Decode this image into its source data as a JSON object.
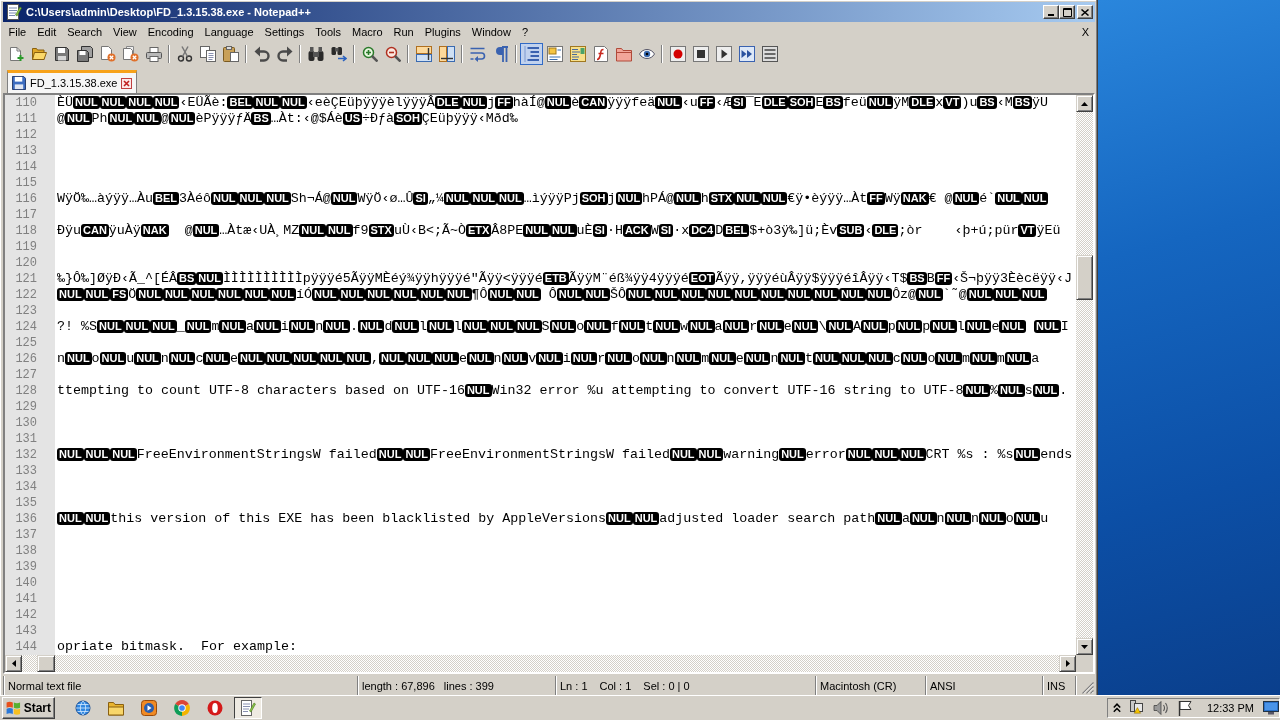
{
  "window": {
    "title": "C:\\Users\\admin\\Desktop\\FD_1.3.15.38.exe - Notepad++"
  },
  "menu": {
    "items": [
      "File",
      "Edit",
      "Search",
      "View",
      "Encoding",
      "Language",
      "Settings",
      "Tools",
      "Macro",
      "Run",
      "Plugins",
      "Window",
      "?"
    ],
    "close": "X"
  },
  "toolbar": [
    [
      {
        "kind": "new",
        "on": false
      },
      {
        "kind": "open",
        "on": false
      },
      {
        "kind": "save",
        "on": false
      },
      {
        "kind": "saveall",
        "on": false
      },
      {
        "kind": "close",
        "on": false
      },
      {
        "kind": "closeall",
        "on": false
      },
      {
        "kind": "print",
        "on": false
      }
    ],
    [
      {
        "kind": "cut",
        "on": false
      },
      {
        "kind": "copy",
        "on": false
      },
      {
        "kind": "paste",
        "on": false
      }
    ],
    [
      {
        "kind": "undo",
        "on": false
      },
      {
        "kind": "redo",
        "on": false
      }
    ],
    [
      {
        "kind": "find",
        "on": false
      },
      {
        "kind": "replace",
        "on": false
      }
    ],
    [
      {
        "kind": "zoomin",
        "on": false
      },
      {
        "kind": "zoomout",
        "on": false
      }
    ],
    [
      {
        "kind": "syncv",
        "on": false
      },
      {
        "kind": "synch",
        "on": false
      }
    ],
    [
      {
        "kind": "wrap",
        "on": false
      },
      {
        "kind": "allchars",
        "on": false
      }
    ],
    [
      {
        "kind": "indent",
        "on": true
      },
      {
        "kind": "userlang",
        "on": false
      },
      {
        "kind": "docmap",
        "on": false
      },
      {
        "kind": "funclist",
        "on": false
      },
      {
        "kind": "folder",
        "on": false
      },
      {
        "kind": "monitor",
        "on": false
      }
    ],
    [
      {
        "kind": "record",
        "on": false
      },
      {
        "kind": "stop",
        "on": false
      },
      {
        "kind": "play",
        "on": false
      },
      {
        "kind": "playmulti",
        "on": false
      },
      {
        "kind": "savemacro",
        "on": false
      }
    ]
  ],
  "tabs": [
    {
      "label": "FD_1.3.15.38.exe",
      "selected": true,
      "modified": false
    }
  ],
  "editor": {
    "lines": [
      {
        "number": "110",
        "segments": [
          {
            "kind": "text",
            "text": "ÈÜ"
          },
          {
            "kind": "control",
            "text": "NUL"
          },
          {
            "kind": "control",
            "text": "NUL"
          },
          {
            "kind": "control",
            "text": "NUL"
          },
          {
            "kind": "control",
            "text": "NUL"
          },
          {
            "kind": "text",
            "text": "‹EÜÃè:"
          },
          {
            "kind": "control",
            "text": "BEL"
          },
          {
            "kind": "control",
            "text": "NUL"
          },
          {
            "kind": "control",
            "text": "NUL"
          },
          {
            "kind": "text",
            "text": "‹eèÇEüþÿÿÿèlÿÿÿÂ"
          },
          {
            "kind": "control",
            "text": "DLE"
          },
          {
            "kind": "control",
            "text": "NUL"
          },
          {
            "kind": "text",
            "text": "j"
          },
          {
            "kind": "control",
            "text": "FF"
          },
          {
            "kind": "text",
            "text": "hàÍ@"
          },
          {
            "kind": "control",
            "text": "NUL"
          },
          {
            "kind": "text",
            "text": "è"
          },
          {
            "kind": "control",
            "text": "CAN"
          },
          {
            "kind": "text",
            "text": "ÿÿÿfeä"
          },
          {
            "kind": "control",
            "text": "NUL"
          },
          {
            "kind": "text",
            "text": "‹u"
          },
          {
            "kind": "control",
            "text": "FF"
          },
          {
            "kind": "text",
            "text": "‹Æ"
          },
          {
            "kind": "control",
            "text": "SI"
          },
          {
            "kind": "text",
            "text": "¯E"
          },
          {
            "kind": "control",
            "text": "DLE"
          },
          {
            "kind": "control",
            "text": "SOH"
          },
          {
            "kind": "text",
            "text": "E"
          },
          {
            "kind": "control",
            "text": "BS"
          },
          {
            "kind": "text",
            "text": "feü"
          },
          {
            "kind": "control",
            "text": "NUL"
          },
          {
            "kind": "text",
            "text": "ÿM"
          },
          {
            "kind": "control",
            "text": "DLE"
          },
          {
            "kind": "text",
            "text": "x"
          },
          {
            "kind": "control",
            "text": "VT"
          },
          {
            "kind": "text",
            "text": ")u"
          },
          {
            "kind": "control",
            "text": "BS"
          },
          {
            "kind": "text",
            "text": "‹M"
          },
          {
            "kind": "control",
            "text": "BS"
          },
          {
            "kind": "text",
            "text": "ÿU"
          }
        ]
      },
      {
        "number": "111",
        "segments": [
          {
            "kind": "text",
            "text": "@"
          },
          {
            "kind": "control",
            "text": "NUL"
          },
          {
            "kind": "text",
            "text": "Ph"
          },
          {
            "kind": "control",
            "text": "NUL"
          },
          {
            "kind": "control",
            "text": "NUL"
          },
          {
            "kind": "text",
            "text": "@"
          },
          {
            "kind": "control",
            "text": "NUL"
          },
          {
            "kind": "text",
            "text": "èPÿÿÿƒÄ"
          },
          {
            "kind": "control",
            "text": "BS"
          },
          {
            "kind": "text",
            "text": "…Àt:‹@$Áè"
          },
          {
            "kind": "control",
            "text": "US"
          },
          {
            "kind": "text",
            "text": "÷Ðƒà"
          },
          {
            "kind": "control",
            "text": "SOH"
          },
          {
            "kind": "text",
            "text": "ÇEüþÿÿÿ‹Mðd‰"
          }
        ]
      },
      {
        "number": "112"
      },
      {
        "number": "113"
      },
      {
        "number": "114"
      },
      {
        "number": "115"
      },
      {
        "number": "116",
        "segments": [
          {
            "kind": "text",
            "text": "WÿÖ‰…àýÿÿ…Àu"
          },
          {
            "kind": "control",
            "text": "BEL"
          },
          {
            "kind": "text",
            "text": "3Àéô"
          },
          {
            "kind": "control",
            "text": "NUL"
          },
          {
            "kind": "control",
            "text": "NUL"
          },
          {
            "kind": "control",
            "text": "NUL"
          },
          {
            "kind": "text",
            "text": "Sh¬Á@"
          },
          {
            "kind": "control",
            "text": "NUL"
          },
          {
            "kind": "text",
            "text": "WÿÖ‹ø…Û"
          },
          {
            "kind": "control",
            "text": "SI"
          },
          {
            "kind": "text",
            "text": "„¼"
          },
          {
            "kind": "control",
            "text": "NUL"
          },
          {
            "kind": "control",
            "text": "NUL"
          },
          {
            "kind": "control",
            "text": "NUL"
          },
          {
            "kind": "text",
            "text": "…ìýÿÿPj"
          },
          {
            "kind": "control",
            "text": "SOH"
          },
          {
            "kind": "text",
            "text": "j"
          },
          {
            "kind": "control",
            "text": "NUL"
          },
          {
            "kind": "text",
            "text": "hPÁ@"
          },
          {
            "kind": "control",
            "text": "NUL"
          },
          {
            "kind": "text",
            "text": "h"
          },
          {
            "kind": "control",
            "text": "STX"
          },
          {
            "kind": "control",
            "text": "NUL"
          },
          {
            "kind": "control",
            "text": "NUL"
          },
          {
            "kind": "text",
            "text": "€ÿ•èýÿÿ…Àt"
          },
          {
            "kind": "control",
            "text": "FF"
          },
          {
            "kind": "text",
            "text": "Wÿ"
          },
          {
            "kind": "control",
            "text": "NAK"
          },
          {
            "kind": "text",
            "text": "€ @"
          },
          {
            "kind": "control",
            "text": "NUL"
          },
          {
            "kind": "text",
            "text": "é`"
          },
          {
            "kind": "control",
            "text": "NUL"
          },
          {
            "kind": "control",
            "text": "NUL"
          }
        ]
      },
      {
        "number": "117"
      },
      {
        "number": "118",
        "segments": [
          {
            "kind": "text",
            "text": "Ðÿu"
          },
          {
            "kind": "control",
            "text": "CAN"
          },
          {
            "kind": "text",
            "text": "ÿuÀÿ"
          },
          {
            "kind": "control",
            "text": "NAK"
          },
          {
            "kind": "text",
            "text": "  @"
          },
          {
            "kind": "control",
            "text": "NUL"
          },
          {
            "kind": "text",
            "text": "…Àtæ‹UÀ¸MZ"
          },
          {
            "kind": "control",
            "text": "NUL"
          },
          {
            "kind": "control",
            "text": "NUL"
          },
          {
            "kind": "text",
            "text": "f9"
          },
          {
            "kind": "control",
            "text": "STX"
          },
          {
            "kind": "text",
            "text": "uÙ‹B<;Ã~Ò"
          },
          {
            "kind": "control",
            "text": "ETX"
          },
          {
            "kind": "text",
            "text": "Â8PE"
          },
          {
            "kind": "control",
            "text": "NUL"
          },
          {
            "kind": "control",
            "text": "NUL"
          },
          {
            "kind": "text",
            "text": "uÈ"
          },
          {
            "kind": "control",
            "text": "SI"
          },
          {
            "kind": "text",
            "text": "·H"
          },
          {
            "kind": "control",
            "text": "ACK"
          },
          {
            "kind": "text",
            "text": "W"
          },
          {
            "kind": "control",
            "text": "SI"
          },
          {
            "kind": "text",
            "text": "·x"
          },
          {
            "kind": "control",
            "text": "DC4"
          },
          {
            "kind": "text",
            "text": "D"
          },
          {
            "kind": "control",
            "text": "BEL"
          },
          {
            "kind": "text",
            "text": "$+ò3ÿ‰]ü;Èv"
          },
          {
            "kind": "control",
            "text": "SUB"
          },
          {
            "kind": "text",
            "text": "‹"
          },
          {
            "kind": "control",
            "text": "DLE"
          },
          {
            "kind": "text",
            "text": ";òr    ‹þ+ú;pür"
          },
          {
            "kind": "control",
            "text": "VT"
          },
          {
            "kind": "text",
            "text": "ÿEü"
          }
        ]
      },
      {
        "number": "119"
      },
      {
        "number": "120"
      },
      {
        "number": "121",
        "segments": [
          {
            "kind": "text",
            "text": "‰}Ô‰]ØÿÐ‹Ã_^[ÉÂ"
          },
          {
            "kind": "control",
            "text": "BS"
          },
          {
            "kind": "control",
            "text": "NUL"
          },
          {
            "kind": "text",
            "text": "ÌÌÌÌÌÌÌÌÌÌpÿÿÿé5ÃÿÿMÈéý¾ÿÿhÿÿÿé\"Ãÿÿ<ÿÿÿé"
          },
          {
            "kind": "control",
            "text": "ETB"
          },
          {
            "kind": "text",
            "text": "ÃÿÿM¨éß¾ÿÿ4ÿÿÿé"
          },
          {
            "kind": "control",
            "text": "EOT"
          },
          {
            "kind": "text",
            "text": "Ãÿÿ,ÿÿÿéùÂÿÿ$ÿÿÿéîÂÿÿ‹T$"
          },
          {
            "kind": "control",
            "text": "BS"
          },
          {
            "kind": "text",
            "text": "B"
          },
          {
            "kind": "control",
            "text": "FF"
          },
          {
            "kind": "text",
            "text": "‹Š¬þÿÿ3Èècëÿÿ‹J"
          }
        ]
      },
      {
        "number": "122",
        "segments": [
          {
            "kind": "control",
            "text": "NUL"
          },
          {
            "kind": "control",
            "text": "NUL"
          },
          {
            "kind": "control",
            "text": "FS"
          },
          {
            "kind": "text",
            "text": "Ö"
          },
          {
            "kind": "control",
            "text": "NUL"
          },
          {
            "kind": "control",
            "text": "NUL"
          },
          {
            "kind": "control",
            "text": "NUL"
          },
          {
            "kind": "control",
            "text": "NUL"
          },
          {
            "kind": "control",
            "text": "NUL"
          },
          {
            "kind": "control",
            "text": "NUL"
          },
          {
            "kind": "text",
            "text": "íÓ"
          },
          {
            "kind": "control",
            "text": "NUL"
          },
          {
            "kind": "control",
            "text": "NUL"
          },
          {
            "kind": "control",
            "text": "NUL"
          },
          {
            "kind": "control",
            "text": "NUL"
          },
          {
            "kind": "control",
            "text": "NUL"
          },
          {
            "kind": "control",
            "text": "NUL"
          },
          {
            "kind": "text",
            "text": "¶Ô"
          },
          {
            "kind": "control",
            "text": "NUL"
          },
          {
            "kind": "control",
            "text": "NUL"
          },
          {
            "kind": "text",
            "text": " Ô"
          },
          {
            "kind": "control",
            "text": "NUL"
          },
          {
            "kind": "control",
            "text": "NUL"
          },
          {
            "kind": "text",
            "text": "ŠÔ"
          },
          {
            "kind": "control",
            "text": "NUL"
          },
          {
            "kind": "control",
            "text": "NUL"
          },
          {
            "kind": "control",
            "text": "NUL"
          },
          {
            "kind": "control",
            "text": "NUL"
          },
          {
            "kind": "control",
            "text": "NUL"
          },
          {
            "kind": "control",
            "text": "NUL"
          },
          {
            "kind": "control",
            "text": "NUL"
          },
          {
            "kind": "control",
            "text": "NUL"
          },
          {
            "kind": "control",
            "text": "NUL"
          },
          {
            "kind": "control",
            "text": "NUL"
          },
          {
            "kind": "text",
            "text": "Ôz@"
          },
          {
            "kind": "control",
            "text": "NUL"
          },
          {
            "kind": "text",
            "text": "`˜@"
          },
          {
            "kind": "control",
            "text": "NUL"
          },
          {
            "kind": "control",
            "text": "NUL"
          },
          {
            "kind": "control",
            "text": "NUL"
          }
        ]
      },
      {
        "number": "123"
      },
      {
        "number": "124",
        "segments": [
          {
            "kind": "text",
            "text": "?! %S"
          },
          {
            "kind": "control",
            "text": "NUL"
          },
          {
            "kind": "control",
            "text": "NUL"
          },
          {
            "kind": "control",
            "text": "NUL"
          },
          {
            "kind": "text",
            "text": "_"
          },
          {
            "kind": "control",
            "text": "NUL"
          },
          {
            "kind": "text",
            "text": "m"
          },
          {
            "kind": "control",
            "text": "NUL"
          },
          {
            "kind": "text",
            "text": "a"
          },
          {
            "kind": "control",
            "text": "NUL"
          },
          {
            "kind": "text",
            "text": "i"
          },
          {
            "kind": "control",
            "text": "NUL"
          },
          {
            "kind": "text",
            "text": "n"
          },
          {
            "kind": "control",
            "text": "NUL"
          },
          {
            "kind": "text",
            "text": "."
          },
          {
            "kind": "control",
            "text": "NUL"
          },
          {
            "kind": "text",
            "text": "d"
          },
          {
            "kind": "control",
            "text": "NUL"
          },
          {
            "kind": "text",
            "text": "l"
          },
          {
            "kind": "control",
            "text": "NUL"
          },
          {
            "kind": "text",
            "text": "l"
          },
          {
            "kind": "control",
            "text": "NUL"
          },
          {
            "kind": "control",
            "text": "NUL"
          },
          {
            "kind": "control",
            "text": "NUL"
          },
          {
            "kind": "text",
            "text": "S"
          },
          {
            "kind": "control",
            "text": "NUL"
          },
          {
            "kind": "text",
            "text": "o"
          },
          {
            "kind": "control",
            "text": "NUL"
          },
          {
            "kind": "text",
            "text": "f"
          },
          {
            "kind": "control",
            "text": "NUL"
          },
          {
            "kind": "text",
            "text": "t"
          },
          {
            "kind": "control",
            "text": "NUL"
          },
          {
            "kind": "text",
            "text": "w"
          },
          {
            "kind": "control",
            "text": "NUL"
          },
          {
            "kind": "text",
            "text": "a"
          },
          {
            "kind": "control",
            "text": "NUL"
          },
          {
            "kind": "text",
            "text": "r"
          },
          {
            "kind": "control",
            "text": "NUL"
          },
          {
            "kind": "text",
            "text": "e"
          },
          {
            "kind": "control",
            "text": "NUL"
          },
          {
            "kind": "text",
            "text": "\\"
          },
          {
            "kind": "control",
            "text": "NUL"
          },
          {
            "kind": "text",
            "text": "A"
          },
          {
            "kind": "control",
            "text": "NUL"
          },
          {
            "kind": "text",
            "text": "p"
          },
          {
            "kind": "control",
            "text": "NUL"
          },
          {
            "kind": "text",
            "text": "p"
          },
          {
            "kind": "control",
            "text": "NUL"
          },
          {
            "kind": "text",
            "text": "l"
          },
          {
            "kind": "control",
            "text": "NUL"
          },
          {
            "kind": "text",
            "text": "e"
          },
          {
            "kind": "control",
            "text": "NUL"
          },
          {
            "kind": "space"
          },
          {
            "kind": "control",
            "text": "NUL"
          },
          {
            "kind": "text",
            "text": "I"
          }
        ]
      },
      {
        "number": "125"
      },
      {
        "number": "126",
        "segments": [
          {
            "kind": "text",
            "text": "n"
          },
          {
            "kind": "control",
            "text": "NUL"
          },
          {
            "kind": "text",
            "text": "o"
          },
          {
            "kind": "control",
            "text": "NUL"
          },
          {
            "kind": "text",
            "text": "u"
          },
          {
            "kind": "control",
            "text": "NUL"
          },
          {
            "kind": "text",
            "text": "n"
          },
          {
            "kind": "control",
            "text": "NUL"
          },
          {
            "kind": "text",
            "text": "c"
          },
          {
            "kind": "control",
            "text": "NUL"
          },
          {
            "kind": "text",
            "text": "e"
          },
          {
            "kind": "control",
            "text": "NUL"
          },
          {
            "kind": "control",
            "text": "NUL"
          },
          {
            "kind": "control",
            "text": "NUL"
          },
          {
            "kind": "control",
            "text": "NUL"
          },
          {
            "kind": "control",
            "text": "NUL"
          },
          {
            "kind": "text",
            "text": ","
          },
          {
            "kind": "control",
            "text": "NUL"
          },
          {
            "kind": "control",
            "text": "NUL"
          },
          {
            "kind": "control",
            "text": "NUL"
          },
          {
            "kind": "text",
            "text": "e"
          },
          {
            "kind": "control",
            "text": "NUL"
          },
          {
            "kind": "text",
            "text": "n"
          },
          {
            "kind": "control",
            "text": "NUL"
          },
          {
            "kind": "text",
            "text": "v"
          },
          {
            "kind": "control",
            "text": "NUL"
          },
          {
            "kind": "text",
            "text": "i"
          },
          {
            "kind": "control",
            "text": "NUL"
          },
          {
            "kind": "text",
            "text": "r"
          },
          {
            "kind": "control",
            "text": "NUL"
          },
          {
            "kind": "text",
            "text": "o"
          },
          {
            "kind": "control",
            "text": "NUL"
          },
          {
            "kind": "text",
            "text": "n"
          },
          {
            "kind": "control",
            "text": "NUL"
          },
          {
            "kind": "text",
            "text": "m"
          },
          {
            "kind": "control",
            "text": "NUL"
          },
          {
            "kind": "text",
            "text": "e"
          },
          {
            "kind": "control",
            "text": "NUL"
          },
          {
            "kind": "text",
            "text": "n"
          },
          {
            "kind": "control",
            "text": "NUL"
          },
          {
            "kind": "text",
            "text": "t"
          },
          {
            "kind": "control",
            "text": "NUL"
          },
          {
            "kind": "control",
            "text": "NUL"
          },
          {
            "kind": "control",
            "text": "NUL"
          },
          {
            "kind": "text",
            "text": "c"
          },
          {
            "kind": "control",
            "text": "NUL"
          },
          {
            "kind": "text",
            "text": "o"
          },
          {
            "kind": "control",
            "text": "NUL"
          },
          {
            "kind": "text",
            "text": "m"
          },
          {
            "kind": "control",
            "text": "NUL"
          },
          {
            "kind": "text",
            "text": "m"
          },
          {
            "kind": "control",
            "text": "NUL"
          },
          {
            "kind": "text",
            "text": "a"
          }
        ]
      },
      {
        "number": "127"
      },
      {
        "number": "128",
        "segments": [
          {
            "kind": "text",
            "text": "ttempting to count UTF-8 characters based on UTF-16"
          },
          {
            "kind": "control",
            "text": "NUL"
          },
          {
            "kind": "text",
            "text": "Win32 error %u attempting to convert UTF-16 string to UTF-8"
          },
          {
            "kind": "control",
            "text": "NUL"
          },
          {
            "kind": "text",
            "text": "%"
          },
          {
            "kind": "control",
            "text": "NUL"
          },
          {
            "kind": "text",
            "text": "s"
          },
          {
            "kind": "control",
            "text": "NUL"
          },
          {
            "kind": "text",
            "text": "."
          }
        ]
      },
      {
        "number": "129"
      },
      {
        "number": "130"
      },
      {
        "number": "131"
      },
      {
        "number": "132",
        "segments": [
          {
            "kind": "control",
            "text": "NUL"
          },
          {
            "kind": "control",
            "text": "NUL"
          },
          {
            "kind": "control",
            "text": "NUL"
          },
          {
            "kind": "text",
            "text": "FreeEnvironmentStringsW failed"
          },
          {
            "kind": "control",
            "text": "NUL"
          },
          {
            "kind": "control",
            "text": "NUL"
          },
          {
            "kind": "text",
            "text": "FreeEnvironmentStringsW failed"
          },
          {
            "kind": "control",
            "text": "NUL"
          },
          {
            "kind": "control",
            "text": "NUL"
          },
          {
            "kind": "text",
            "text": "warning"
          },
          {
            "kind": "control",
            "text": "NUL"
          },
          {
            "kind": "text",
            "text": "error"
          },
          {
            "kind": "control",
            "text": "NUL"
          },
          {
            "kind": "control",
            "text": "NUL"
          },
          {
            "kind": "control",
            "text": "NUL"
          },
          {
            "kind": "text",
            "text": "CRT %s : %s"
          },
          {
            "kind": "control",
            "text": "NUL"
          },
          {
            "kind": "text",
            "text": "ends"
          }
        ]
      },
      {
        "number": "133"
      },
      {
        "number": "134"
      },
      {
        "number": "135"
      },
      {
        "number": "136",
        "segments": [
          {
            "kind": "control",
            "text": "NUL"
          },
          {
            "kind": "control",
            "text": "NUL"
          },
          {
            "kind": "text",
            "text": "this version of this EXE has been blacklisted by AppleVersions"
          },
          {
            "kind": "control",
            "text": "NUL"
          },
          {
            "kind": "control",
            "text": "NUL"
          },
          {
            "kind": "text",
            "text": "adjusted loader search path"
          },
          {
            "kind": "control",
            "text": "NUL"
          },
          {
            "kind": "text",
            "text": "a"
          },
          {
            "kind": "control",
            "text": "NUL"
          },
          {
            "kind": "text",
            "text": "n"
          },
          {
            "kind": "control",
            "text": "NUL"
          },
          {
            "kind": "text",
            "text": "n"
          },
          {
            "kind": "control",
            "text": "NUL"
          },
          {
            "kind": "text",
            "text": "o"
          },
          {
            "kind": "control",
            "text": "NUL"
          },
          {
            "kind": "text",
            "text": "u"
          }
        ]
      },
      {
        "number": "137"
      },
      {
        "number": "138"
      },
      {
        "number": "139"
      },
      {
        "number": "140"
      },
      {
        "number": "141"
      },
      {
        "number": "142"
      },
      {
        "number": "143"
      },
      {
        "number": "144",
        "segments": [
          {
            "kind": "text",
            "text": "opriate bitmask.  For example:"
          }
        ]
      }
    ]
  },
  "status_bar": {
    "file_type": "Normal text file",
    "length": "length : 67,896",
    "lines": "lines : 399",
    "line": "Ln : 1",
    "column": "Col : 1",
    "selection": "Sel : 0 | 0",
    "eol": "Macintosh (CR)",
    "encoding": "ANSI",
    "mode": "INS"
  },
  "taskbar": {
    "start": "Start",
    "apps": [
      {
        "kind": "ie",
        "selected": false
      },
      {
        "kind": "explorer",
        "selected": false
      },
      {
        "kind": "mediaplayer",
        "selected": false
      },
      {
        "kind": "chrome",
        "selected": false
      },
      {
        "kind": "opera",
        "selected": false
      },
      {
        "kind": "notepad",
        "selected": true
      }
    ],
    "clock": "12:33 PM"
  }
}
